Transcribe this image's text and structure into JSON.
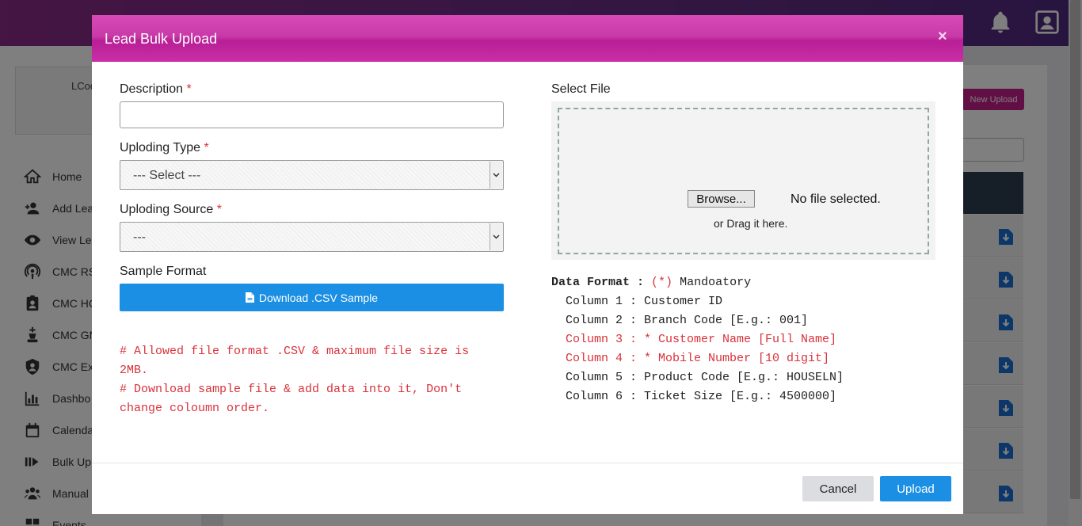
{
  "background": {
    "card_text": "LCod",
    "nav": [
      {
        "label": "Home",
        "icon": "home-icon"
      },
      {
        "label": "Add Lea",
        "icon": "add-user-icon"
      },
      {
        "label": "View Le",
        "icon": "eye-icon"
      },
      {
        "label": "CMC RS",
        "icon": "podcast-icon"
      },
      {
        "label": "CMC HC",
        "icon": "id-badge-icon"
      },
      {
        "label": "CMC GN",
        "icon": "chess-king-icon"
      },
      {
        "label": "CMC Ex",
        "icon": "shield-user-icon"
      },
      {
        "label": "Dashbo",
        "icon": "bar-chart-icon"
      },
      {
        "label": "Calenda",
        "icon": "calendar-icon"
      },
      {
        "label": "Bulk Upl",
        "icon": "bulk-upload-icon"
      },
      {
        "label": "Manual",
        "icon": "users-icon"
      },
      {
        "label": "Events",
        "icon": "grid-icon"
      }
    ],
    "new_upload_label": "New Upload"
  },
  "modal": {
    "title": "Lead Bulk Upload",
    "close": "×",
    "description_label": "Description",
    "required_mark": "*",
    "description_value": "",
    "type_label": "Uploding Type",
    "type_selected": "--- Select ---",
    "source_label": "Uploding Source",
    "source_selected": "---",
    "sample_format_label": "Sample Format",
    "download_button": "Download .CSV Sample",
    "notes": [
      "# Allowed file format .CSV & maximum file size is",
      "2MB.",
      "# Download sample file & add data into it, Don't",
      "change coloumn order."
    ],
    "select_file_label": "Select File",
    "browse_button": "Browse...",
    "no_file_text": "No file selected.",
    "drag_text": "or Drag it here.",
    "data_format": {
      "heading": "Data Format :",
      "mandatory_mark": "(*)",
      "mandatory_text": "Mandoatory",
      "columns": [
        {
          "text": "  Column 1 : Customer ID",
          "required": false
        },
        {
          "text": "  Column 2 : Branch Code [E.g.: 001]",
          "required": false
        },
        {
          "text": "  Column 3 : * Customer Name [Full Name]",
          "required": true
        },
        {
          "text": "  Column 4 : * Mobile Number [10 digit]",
          "required": true
        },
        {
          "text": "  Column 5 : Product Code [E.g.: HOUSELN]",
          "required": false
        },
        {
          "text": "  Column 6 : Ticket Size [E.g.: 4500000]",
          "required": false
        }
      ]
    },
    "cancel_button": "Cancel",
    "upload_button": "Upload"
  },
  "colors": {
    "header_magenta": "#c93aa9",
    "primary_blue": "#1a8fe3",
    "required_red": "#d9323a"
  }
}
